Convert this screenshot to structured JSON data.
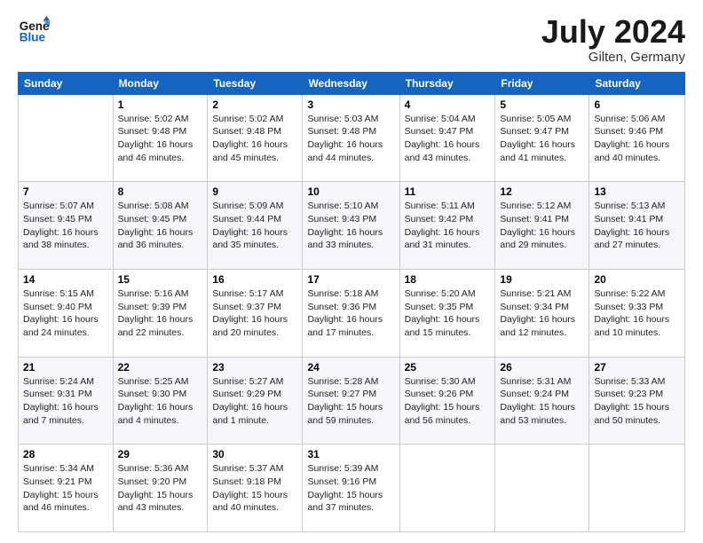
{
  "header": {
    "logo_line1": "General",
    "logo_line2": "Blue",
    "month": "July 2024",
    "location": "Gilten, Germany"
  },
  "weekdays": [
    "Sunday",
    "Monday",
    "Tuesday",
    "Wednesday",
    "Thursday",
    "Friday",
    "Saturday"
  ],
  "weeks": [
    [
      {
        "day": "",
        "sunrise": "",
        "sunset": "",
        "daylight": ""
      },
      {
        "day": "1",
        "sunrise": "5:02 AM",
        "sunset": "9:48 PM",
        "daylight": "16 hours and 46 minutes."
      },
      {
        "day": "2",
        "sunrise": "5:02 AM",
        "sunset": "9:48 PM",
        "daylight": "16 hours and 45 minutes."
      },
      {
        "day": "3",
        "sunrise": "5:03 AM",
        "sunset": "9:48 PM",
        "daylight": "16 hours and 44 minutes."
      },
      {
        "day": "4",
        "sunrise": "5:04 AM",
        "sunset": "9:47 PM",
        "daylight": "16 hours and 43 minutes."
      },
      {
        "day": "5",
        "sunrise": "5:05 AM",
        "sunset": "9:47 PM",
        "daylight": "16 hours and 41 minutes."
      },
      {
        "day": "6",
        "sunrise": "5:06 AM",
        "sunset": "9:46 PM",
        "daylight": "16 hours and 40 minutes."
      }
    ],
    [
      {
        "day": "7",
        "sunrise": "5:07 AM",
        "sunset": "9:45 PM",
        "daylight": "16 hours and 38 minutes."
      },
      {
        "day": "8",
        "sunrise": "5:08 AM",
        "sunset": "9:45 PM",
        "daylight": "16 hours and 36 minutes."
      },
      {
        "day": "9",
        "sunrise": "5:09 AM",
        "sunset": "9:44 PM",
        "daylight": "16 hours and 35 minutes."
      },
      {
        "day": "10",
        "sunrise": "5:10 AM",
        "sunset": "9:43 PM",
        "daylight": "16 hours and 33 minutes."
      },
      {
        "day": "11",
        "sunrise": "5:11 AM",
        "sunset": "9:42 PM",
        "daylight": "16 hours and 31 minutes."
      },
      {
        "day": "12",
        "sunrise": "5:12 AM",
        "sunset": "9:41 PM",
        "daylight": "16 hours and 29 minutes."
      },
      {
        "day": "13",
        "sunrise": "5:13 AM",
        "sunset": "9:41 PM",
        "daylight": "16 hours and 27 minutes."
      }
    ],
    [
      {
        "day": "14",
        "sunrise": "5:15 AM",
        "sunset": "9:40 PM",
        "daylight": "16 hours and 24 minutes."
      },
      {
        "day": "15",
        "sunrise": "5:16 AM",
        "sunset": "9:39 PM",
        "daylight": "16 hours and 22 minutes."
      },
      {
        "day": "16",
        "sunrise": "5:17 AM",
        "sunset": "9:37 PM",
        "daylight": "16 hours and 20 minutes."
      },
      {
        "day": "17",
        "sunrise": "5:18 AM",
        "sunset": "9:36 PM",
        "daylight": "16 hours and 17 minutes."
      },
      {
        "day": "18",
        "sunrise": "5:20 AM",
        "sunset": "9:35 PM",
        "daylight": "16 hours and 15 minutes."
      },
      {
        "day": "19",
        "sunrise": "5:21 AM",
        "sunset": "9:34 PM",
        "daylight": "16 hours and 12 minutes."
      },
      {
        "day": "20",
        "sunrise": "5:22 AM",
        "sunset": "9:33 PM",
        "daylight": "16 hours and 10 minutes."
      }
    ],
    [
      {
        "day": "21",
        "sunrise": "5:24 AM",
        "sunset": "9:31 PM",
        "daylight": "16 hours and 7 minutes."
      },
      {
        "day": "22",
        "sunrise": "5:25 AM",
        "sunset": "9:30 PM",
        "daylight": "16 hours and 4 minutes."
      },
      {
        "day": "23",
        "sunrise": "5:27 AM",
        "sunset": "9:29 PM",
        "daylight": "16 hours and 1 minute."
      },
      {
        "day": "24",
        "sunrise": "5:28 AM",
        "sunset": "9:27 PM",
        "daylight": "15 hours and 59 minutes."
      },
      {
        "day": "25",
        "sunrise": "5:30 AM",
        "sunset": "9:26 PM",
        "daylight": "15 hours and 56 minutes."
      },
      {
        "day": "26",
        "sunrise": "5:31 AM",
        "sunset": "9:24 PM",
        "daylight": "15 hours and 53 minutes."
      },
      {
        "day": "27",
        "sunrise": "5:33 AM",
        "sunset": "9:23 PM",
        "daylight": "15 hours and 50 minutes."
      }
    ],
    [
      {
        "day": "28",
        "sunrise": "5:34 AM",
        "sunset": "9:21 PM",
        "daylight": "15 hours and 46 minutes."
      },
      {
        "day": "29",
        "sunrise": "5:36 AM",
        "sunset": "9:20 PM",
        "daylight": "15 hours and 43 minutes."
      },
      {
        "day": "30",
        "sunrise": "5:37 AM",
        "sunset": "9:18 PM",
        "daylight": "15 hours and 40 minutes."
      },
      {
        "day": "31",
        "sunrise": "5:39 AM",
        "sunset": "9:16 PM",
        "daylight": "15 hours and 37 minutes."
      },
      {
        "day": "",
        "sunrise": "",
        "sunset": "",
        "daylight": ""
      },
      {
        "day": "",
        "sunrise": "",
        "sunset": "",
        "daylight": ""
      },
      {
        "day": "",
        "sunrise": "",
        "sunset": "",
        "daylight": ""
      }
    ]
  ]
}
